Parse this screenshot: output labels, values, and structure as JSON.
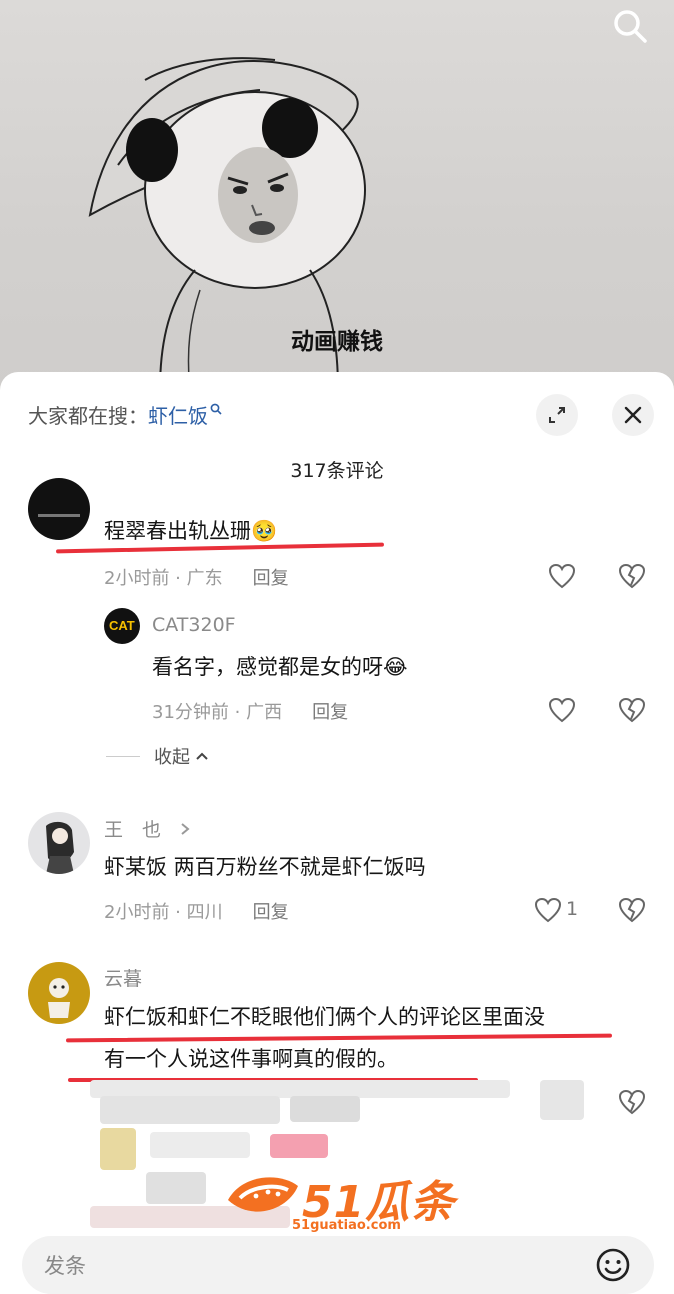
{
  "video": {
    "caption": "动画赚钱"
  },
  "sheet": {
    "hot_search_prefix": "大家都在搜：",
    "hot_search_keyword": "虾仁饭",
    "comment_count": "317条评论",
    "collapse_label": "收起",
    "input_placeholder": "发条"
  },
  "comments": [
    {
      "text": "程翠春出轨丛珊",
      "time": "2小时前 · 广东",
      "reply": "回复"
    },
    {
      "name": "CAT320F",
      "text": "看名字，感觉都是女的呀",
      "time": "31分钟前 · 广西",
      "reply": "回复"
    },
    {
      "name": "王　也",
      "text": "虾某饭 两百万粉丝不就是虾仁饭吗",
      "time": "2小时前 · 四川",
      "reply": "回复",
      "likes": "1"
    },
    {
      "name": "云暮",
      "text_line1": "虾仁饭和虾仁不眨眼他们俩个人的评论区里面没",
      "text_line2": "有一个人说这件事啊真的假的。"
    }
  ],
  "watermark": {
    "brand": "51瓜条",
    "url": "51guatiao.com"
  },
  "colors": {
    "accent_link": "#2d5fa6",
    "underline_red": "#e8303a",
    "watermark_orange": "#f37021"
  }
}
